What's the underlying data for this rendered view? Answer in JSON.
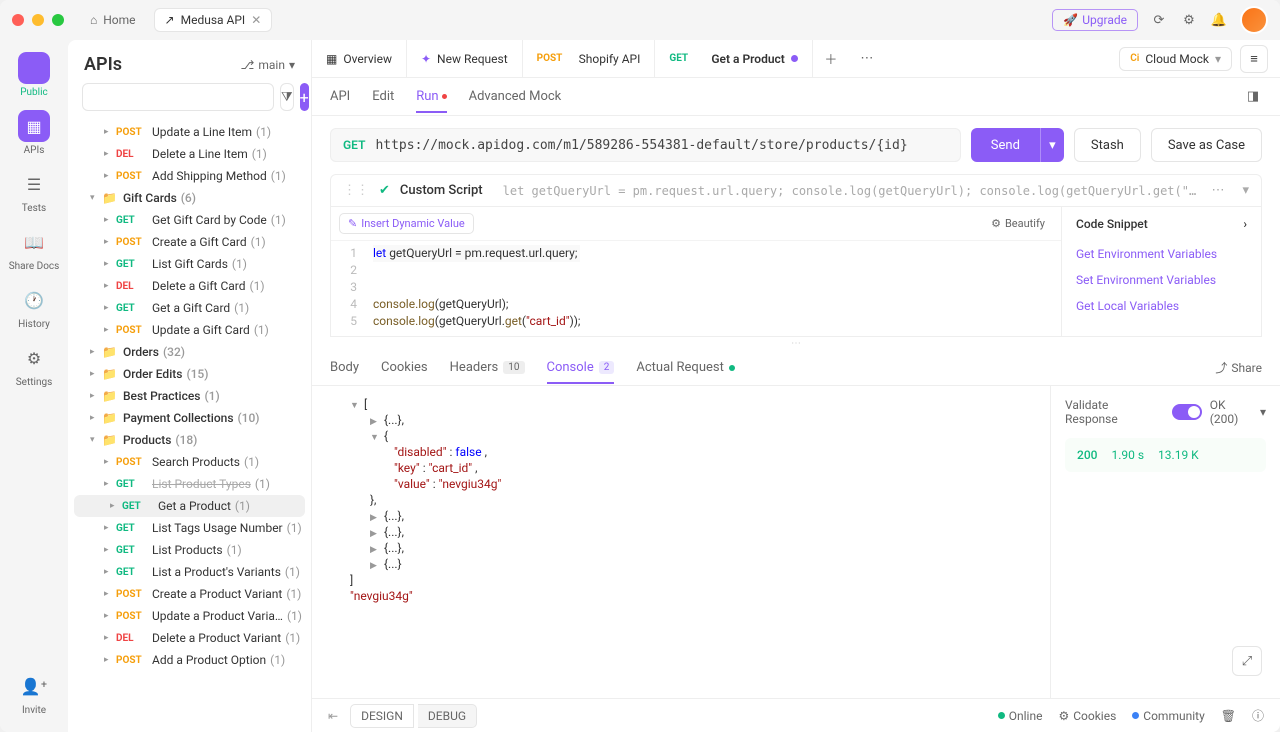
{
  "titlebar": {
    "home": "Home",
    "tab": "Medusa API",
    "upgrade": "Upgrade"
  },
  "rail": {
    "publicLabel": "Public",
    "apis": "APIs",
    "tests": "Tests",
    "shareDocs": "Share Docs",
    "history": "History",
    "settings": "Settings",
    "invite": "Invite"
  },
  "sidebar": {
    "title": "APIs",
    "branch": "main",
    "tree": [
      {
        "indent": 2,
        "method": "POST",
        "label": "Update a Line Item",
        "count": "(1)"
      },
      {
        "indent": 2,
        "method": "DEL",
        "label": "Delete a Line Item",
        "count": "(1)"
      },
      {
        "indent": 2,
        "method": "POST",
        "label": "Add Shipping Method",
        "count": "(1)"
      },
      {
        "indent": 1,
        "folder": true,
        "caret": "▾",
        "label": "Gift Cards",
        "count": "(6)"
      },
      {
        "indent": 2,
        "method": "GET",
        "label": "Get Gift Card by Code",
        "count": "(1)"
      },
      {
        "indent": 2,
        "method": "POST",
        "label": "Create a Gift Card",
        "count": "(1)"
      },
      {
        "indent": 2,
        "method": "GET",
        "label": "List Gift Cards",
        "count": "(1)"
      },
      {
        "indent": 2,
        "method": "DEL",
        "label": "Delete a Gift Card",
        "count": "(1)"
      },
      {
        "indent": 2,
        "method": "GET",
        "label": "Get a Gift Card",
        "count": "(1)"
      },
      {
        "indent": 2,
        "method": "POST",
        "label": "Update a Gift Card",
        "count": "(1)"
      },
      {
        "indent": 1,
        "folder": true,
        "caret": "▸",
        "label": "Orders",
        "count": "(32)"
      },
      {
        "indent": 1,
        "folder": true,
        "caret": "▸",
        "label": "Order Edits",
        "count": "(15)"
      },
      {
        "indent": 1,
        "folder": true,
        "caret": "▸",
        "label": "Best Practices",
        "count": "(1)"
      },
      {
        "indent": 1,
        "folder": true,
        "caret": "▸",
        "label": "Payment Collections",
        "count": "(10)"
      },
      {
        "indent": 1,
        "folder": true,
        "caret": "▾",
        "label": "Products",
        "count": "(18)"
      },
      {
        "indent": 2,
        "method": "POST",
        "label": "Search Products",
        "count": "(1)"
      },
      {
        "indent": 2,
        "method": "GET",
        "label": "List Product Types",
        "count": "(1)",
        "strike": true
      },
      {
        "indent": 2,
        "method": "GET",
        "label": "Get a Product",
        "count": "(1)",
        "selected": true
      },
      {
        "indent": 2,
        "method": "GET",
        "label": "List Tags Usage Number",
        "count": "(1)"
      },
      {
        "indent": 2,
        "method": "GET",
        "label": "List Products",
        "count": "(1)"
      },
      {
        "indent": 2,
        "method": "GET",
        "label": "List a Product's Variants",
        "count": "(1)"
      },
      {
        "indent": 2,
        "method": "POST",
        "label": "Create a Product Variant",
        "count": "(1)"
      },
      {
        "indent": 2,
        "method": "POST",
        "label": "Update a Product Varia…",
        "count": "(1)"
      },
      {
        "indent": 2,
        "method": "DEL",
        "label": "Delete a Product Variant",
        "count": "(1)"
      },
      {
        "indent": 2,
        "method": "POST",
        "label": "Add a Product Option",
        "count": "(1)"
      }
    ]
  },
  "mainTabs": {
    "overview": "Overview",
    "newRequest": "New Request",
    "shopify": {
      "method": "POST",
      "label": "Shopify API"
    },
    "getProduct": {
      "method": "GET",
      "label": "Get a Product"
    }
  },
  "env": {
    "ci": "Ci",
    "label": "Cloud Mock"
  },
  "subtabs": {
    "api": "API",
    "edit": "Edit",
    "run": "Run",
    "advanced": "Advanced Mock"
  },
  "url": {
    "method": "GET",
    "value": "https://mock.apidog.com/m1/589286-554381-default/store/products/{id}"
  },
  "actions": {
    "send": "Send",
    "stash": "Stash",
    "saveAsCase": "Save as Case"
  },
  "script": {
    "name": "Custom Script",
    "preview": "let getQueryUrl = pm.request.url.query; console.log(getQueryUrl); console.log(getQueryUrl.get(\"cart_id\"));",
    "insertDynamic": "Insert Dynamic Value",
    "beautify": "Beautify",
    "snippetTitle": "Code Snippet",
    "snippets": [
      "Get Environment Variables",
      "Set Environment Variables",
      "Get Local Variables"
    ],
    "lines": {
      "l1a": "let",
      "l1b": " getQueryUrl = pm.request.url.query;",
      "l4a": "console.log",
      "l4b": "(getQueryUrl);",
      "l5a": "console.log",
      "l5b": "(getQueryUrl.",
      "l5c": "get",
      "l5d": "(",
      "l5e": "\"cart_id\"",
      "l5f": "));"
    }
  },
  "resultTabs": {
    "body": "Body",
    "cookies": "Cookies",
    "headers": "Headers",
    "headersCount": "10",
    "console": "Console",
    "consoleCount": "2",
    "actual": "Actual Request",
    "share": "Share"
  },
  "console": {
    "open": "[",
    "collapsed": "{...}",
    "obj": {
      "kDisabled": "\"disabled\"",
      "vDisabled": "false",
      "kKey": "\"key\"",
      "vKey": "\"cart_id\"",
      "kValue": "\"value\"",
      "vValue": "\"nevgiu34g\""
    },
    "close": "]",
    "lastStr": "\"nevgiu34g\""
  },
  "validation": {
    "label": "Validate Response",
    "ok": "OK (200)",
    "status": "200",
    "time": "1.90 s",
    "size": "13.19 K"
  },
  "footer": {
    "design": "DESIGN",
    "debug": "DEBUG",
    "online": "Online",
    "cookies": "Cookies",
    "community": "Community"
  }
}
